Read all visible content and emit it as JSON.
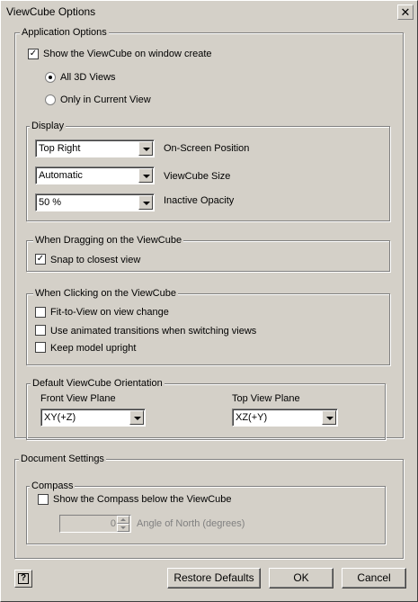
{
  "window": {
    "title": "ViewCube Options",
    "close_glyph": "✕"
  },
  "app_options": {
    "legend": "Application Options",
    "show_viewcube": {
      "label": "Show the ViewCube on window create",
      "checked": true
    },
    "all_3d_views": {
      "label": "All 3D Views",
      "selected": true
    },
    "only_current": {
      "label": "Only in Current View",
      "selected": false
    }
  },
  "display": {
    "legend": "Display",
    "position": {
      "value": "Top Right",
      "label": "On-Screen Position"
    },
    "size": {
      "value": "Automatic",
      "label": "ViewCube Size"
    },
    "opacity": {
      "value": "50 %",
      "label": "Inactive Opacity"
    }
  },
  "dragging": {
    "legend": "When Dragging on the ViewCube",
    "snap": {
      "label": "Snap to closest view",
      "checked": true
    }
  },
  "clicking": {
    "legend": "When Clicking on the ViewCube",
    "fit": {
      "label": "Fit-to-View on view change",
      "checked": false
    },
    "animated": {
      "label": "Use animated transitions when switching views",
      "checked": false
    },
    "upright": {
      "label": "Keep model upright",
      "checked": false
    }
  },
  "orientation": {
    "legend": "Default ViewCube Orientation",
    "front_label": "Front View Plane",
    "front_value": "XY(+Z)",
    "top_label": "Top View Plane",
    "top_value": "XZ(+Y)"
  },
  "doc_settings": {
    "legend": "Document Settings",
    "compass": {
      "legend": "Compass",
      "show": {
        "label": "Show the Compass below the ViewCube",
        "checked": false
      },
      "angle_value": "0",
      "angle_label": "Angle of North (degrees)"
    }
  },
  "buttons": {
    "help": "?",
    "restore": "Restore Defaults",
    "ok": "OK",
    "cancel": "Cancel"
  },
  "check_glyph": "✓",
  "icons": [
    "close-icon",
    "help-icon",
    "chevron-down-icon",
    "spin-up-icon",
    "spin-down-icon"
  ]
}
